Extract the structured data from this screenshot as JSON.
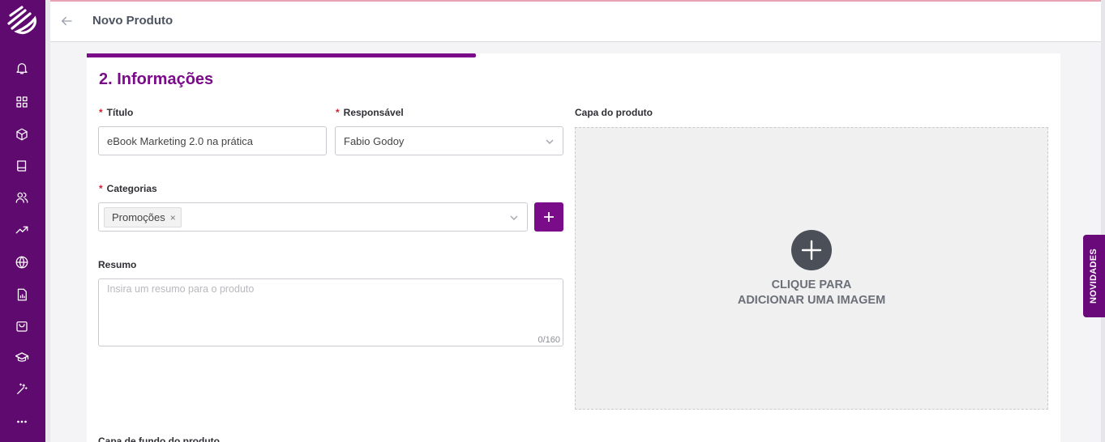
{
  "header": {
    "title": "Novo Produto"
  },
  "section": {
    "title": "2. Informações"
  },
  "form": {
    "titulo_label": "Título",
    "titulo_value": "eBook Marketing 2.0 na prática",
    "responsavel_label": "Responsável",
    "responsavel_value": "Fabio Godoy",
    "categorias_label": "Categorias",
    "categorias_tags": [
      "Promoções"
    ],
    "tag_remove": "×",
    "resumo_label": "Resumo",
    "resumo_placeholder": "Insira um resumo para o produto",
    "resumo_counter": "0/160",
    "capa_label": "Capa do produto",
    "capa_text_line1": "CLIQUE PARA",
    "capa_text_line2": "ADICIONAR UMA IMAGEM",
    "capa_fundo_label": "Capa de fundo do produto",
    "required_mark": "*"
  },
  "sidebar": {
    "icons": [
      "bell-icon",
      "grid-icon",
      "box-icon",
      "book-icon",
      "users-icon",
      "trending-icon",
      "globe-icon",
      "report-icon",
      "shopping-bag-icon",
      "graduation-icon",
      "magic-wand-icon",
      "more-icon"
    ]
  },
  "novidades": {
    "label": "NOVIDADES"
  },
  "colors": {
    "brand": "#7a0b89",
    "sidebar": "#5f0a6e"
  }
}
